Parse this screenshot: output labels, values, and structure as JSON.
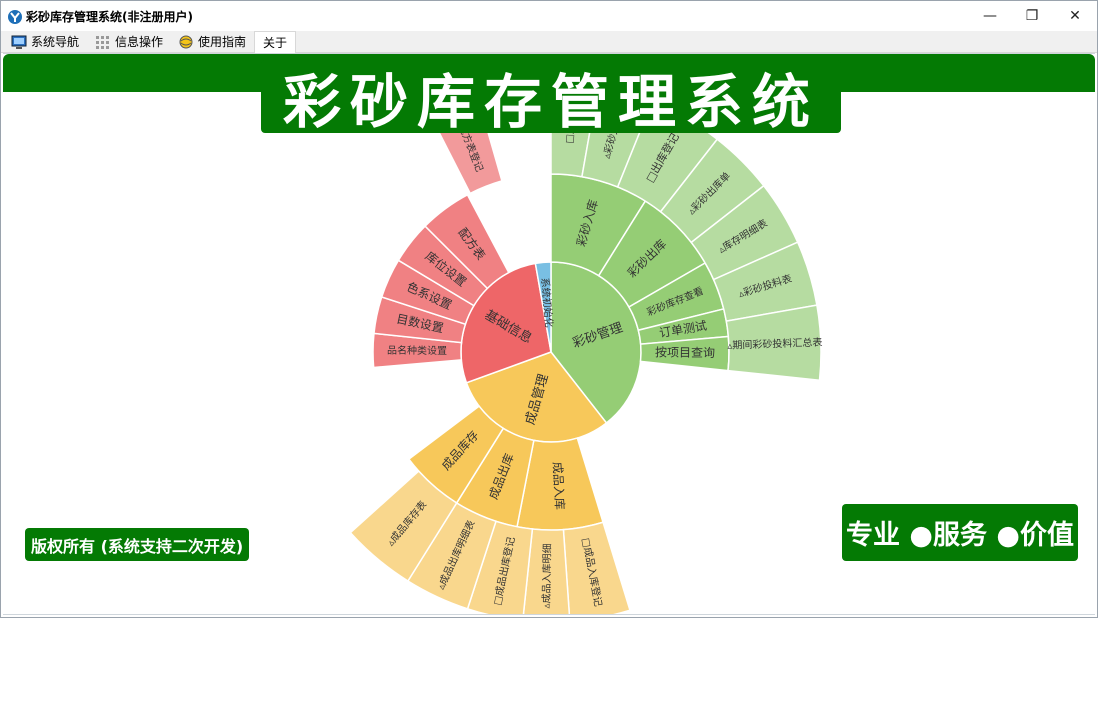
{
  "window": {
    "title": "彩砂库存管理系统(非注册用户)",
    "controls": {
      "minimize": "—",
      "restore": "❐",
      "close": "✕"
    }
  },
  "menubar": {
    "items": [
      {
        "label": "系统导航",
        "icon": "monitor-icon"
      },
      {
        "label": "信息操作",
        "icon": "grid-icon"
      },
      {
        "label": "使用指南",
        "icon": "globe-icon"
      },
      {
        "label": "关于",
        "icon": ""
      }
    ]
  },
  "banner": {
    "title": "彩砂库存管理系统"
  },
  "footer": {
    "copyright": "版权所有 (系统支持二次开发)",
    "slogan": "专业 ●服务 ●价值"
  },
  "colors": {
    "brand_green": "#047a04",
    "sandy_green": "#95cd75",
    "sandy_green_light": "#b6dca1",
    "red": "#ee6668",
    "red_light": "#f08183",
    "yellow": "#f7c85a",
    "yellow_light": "#f9d78d",
    "blue": "#79bfe3"
  },
  "sunburst": {
    "inner": [
      {
        "label": "彩砂管理",
        "color": "#95cd75"
      },
      {
        "label": "成品管理",
        "color": "#f7c85a"
      },
      {
        "label": "基础信息",
        "color": "#ee6668"
      },
      {
        "label": "系统初始化",
        "color": "#79bfe3"
      }
    ],
    "middle": [
      {
        "label": "彩砂入库",
        "group": "彩砂管理"
      },
      {
        "label": "彩砂出库",
        "group": "彩砂管理"
      },
      {
        "label": "彩砂库存查看",
        "group": "彩砂管理"
      },
      {
        "label": "订单测试",
        "group": "彩砂管理"
      },
      {
        "label": "按项目查询",
        "group": "彩砂管理"
      },
      {
        "label": "成品入库",
        "group": "成品管理"
      },
      {
        "label": "成品出库",
        "group": "成品管理"
      },
      {
        "label": "成品库存",
        "group": "成品管理"
      },
      {
        "label": "品名种类设置",
        "group": "基础信息"
      },
      {
        "label": "目数设置",
        "group": "基础信息"
      },
      {
        "label": "色系设置",
        "group": "基础信息"
      },
      {
        "label": "库位设置",
        "group": "基础信息"
      },
      {
        "label": "配方表",
        "group": "基础信息"
      }
    ],
    "outer": [
      {
        "label": "□入库",
        "group": "彩砂入库"
      },
      {
        "label": "▵彩砂入库",
        "group": "彩砂入库"
      },
      {
        "label": "□出库登记",
        "group": "彩砂出库"
      },
      {
        "label": "▵彩砂出库单",
        "group": "彩砂出库"
      },
      {
        "label": "▵库存明细表",
        "group": "彩砂出库"
      },
      {
        "label": "▵彩砂投料表",
        "group": "订单测试"
      },
      {
        "label": "▵期间彩砂投料汇总表",
        "group": "按项目查询"
      },
      {
        "label": "□成品入库登记",
        "group": "成品入库"
      },
      {
        "label": "▵成品入库明细",
        "group": "成品入库"
      },
      {
        "label": "□成品出库登记",
        "group": "成品出库"
      },
      {
        "label": "▵成品出库明细表",
        "group": "成品出库"
      },
      {
        "label": "▵成品库存表",
        "group": "成品库存"
      },
      {
        "label": "□配方表登记",
        "group": "配方表"
      }
    ]
  }
}
